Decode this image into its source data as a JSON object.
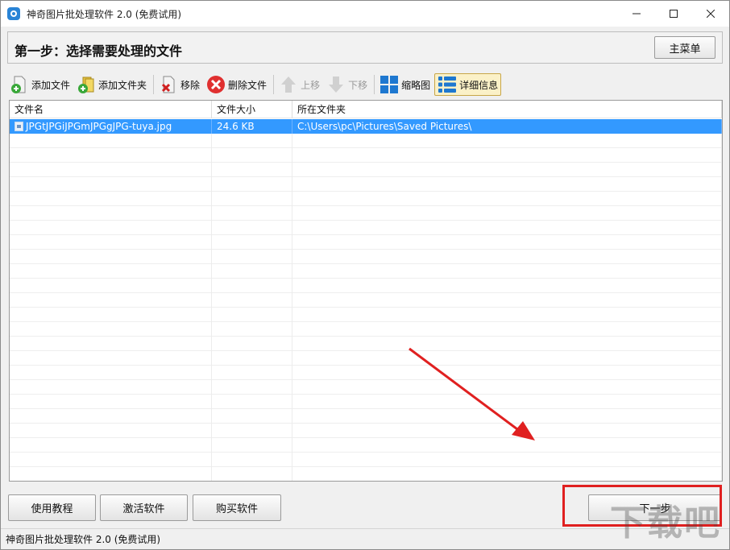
{
  "window": {
    "title": "神奇图片批处理软件 2.0 (免费试用)",
    "controls": {
      "minimize": "minimize-icon",
      "maximize": "maximize-icon",
      "close": "close-icon"
    }
  },
  "step": {
    "title": "第一步：选择需要处理的文件",
    "main_menu_label": "主菜单"
  },
  "toolbar": {
    "add_file": "添加文件",
    "add_folder": "添加文件夹",
    "remove": "移除",
    "delete_file": "删除文件",
    "move_up": "上移",
    "move_down": "下移",
    "thumbnail": "缩略图",
    "details": "详细信息"
  },
  "file_list": {
    "columns": [
      "文件名",
      "文件大小",
      "所在文件夹"
    ],
    "rows": [
      {
        "name": "JPGtJPGiJPGmJPGgJPG-tuya.jpg",
        "size": "24.6 KB",
        "folder": "C:\\Users\\pc\\Pictures\\Saved Pictures\\"
      }
    ]
  },
  "bottom": {
    "tutorial": "使用教程",
    "activate": "激活软件",
    "buy": "购买软件",
    "next": "下一步"
  },
  "status": {
    "text": "神奇图片批处理软件 2.0 (免费试用)"
  },
  "watermark": {
    "text": "下载吧"
  },
  "colors": {
    "selection": "#3399ff",
    "highlight": "#e02020",
    "accent": "#2a84d6"
  }
}
